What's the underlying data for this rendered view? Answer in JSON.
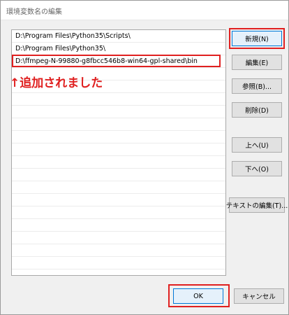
{
  "window": {
    "title": "環境変数名の編集"
  },
  "paths": [
    "D:\\Program Files\\Python35\\Scripts\\",
    "D:\\Program Files\\Python35\\",
    "D:\\ffmpeg-N-99880-g8fbcc546b8-win64-gpl-shared\\bin"
  ],
  "annotation": "↑追加されました",
  "buttons": {
    "new": "新規(N)",
    "edit": "編集(E)",
    "browse": "参照(B)...",
    "delete": "削除(D)",
    "up": "上へ(U)",
    "down": "下へ(O)",
    "edit_text": "テキストの編集(T)...",
    "ok": "OK",
    "cancel": "キャンセル"
  },
  "colors": {
    "annotation_red": "#e02020",
    "focus_blue": "#0078d7"
  }
}
